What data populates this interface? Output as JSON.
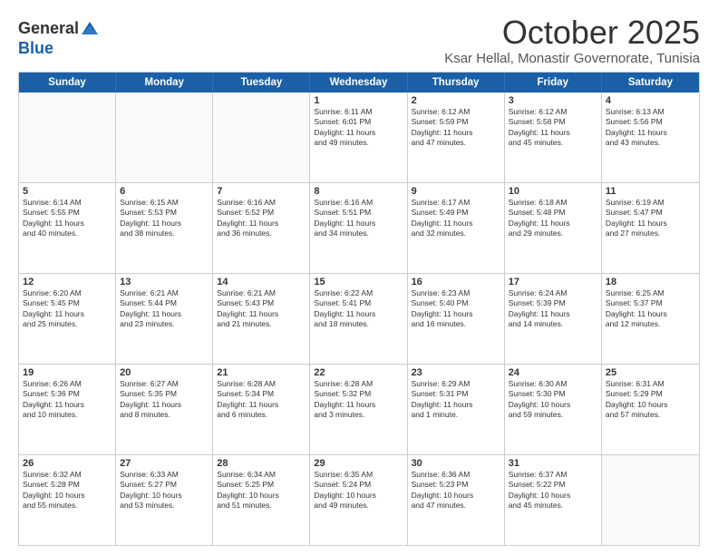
{
  "logo": {
    "general": "General",
    "blue": "Blue"
  },
  "header": {
    "month": "October 2025",
    "location": "Ksar Hellal, Monastir Governorate, Tunisia"
  },
  "weekdays": [
    "Sunday",
    "Monday",
    "Tuesday",
    "Wednesday",
    "Thursday",
    "Friday",
    "Saturday"
  ],
  "rows": [
    [
      {
        "day": "",
        "info": ""
      },
      {
        "day": "",
        "info": ""
      },
      {
        "day": "",
        "info": ""
      },
      {
        "day": "1",
        "info": "Sunrise: 6:11 AM\nSunset: 6:01 PM\nDaylight: 11 hours\nand 49 minutes."
      },
      {
        "day": "2",
        "info": "Sunrise: 6:12 AM\nSunset: 5:59 PM\nDaylight: 11 hours\nand 47 minutes."
      },
      {
        "day": "3",
        "info": "Sunrise: 6:12 AM\nSunset: 5:58 PM\nDaylight: 11 hours\nand 45 minutes."
      },
      {
        "day": "4",
        "info": "Sunrise: 6:13 AM\nSunset: 5:56 PM\nDaylight: 11 hours\nand 43 minutes."
      }
    ],
    [
      {
        "day": "5",
        "info": "Sunrise: 6:14 AM\nSunset: 5:55 PM\nDaylight: 11 hours\nand 40 minutes."
      },
      {
        "day": "6",
        "info": "Sunrise: 6:15 AM\nSunset: 5:53 PM\nDaylight: 11 hours\nand 38 minutes."
      },
      {
        "day": "7",
        "info": "Sunrise: 6:16 AM\nSunset: 5:52 PM\nDaylight: 11 hours\nand 36 minutes."
      },
      {
        "day": "8",
        "info": "Sunrise: 6:16 AM\nSunset: 5:51 PM\nDaylight: 11 hours\nand 34 minutes."
      },
      {
        "day": "9",
        "info": "Sunrise: 6:17 AM\nSunset: 5:49 PM\nDaylight: 11 hours\nand 32 minutes."
      },
      {
        "day": "10",
        "info": "Sunrise: 6:18 AM\nSunset: 5:48 PM\nDaylight: 11 hours\nand 29 minutes."
      },
      {
        "day": "11",
        "info": "Sunrise: 6:19 AM\nSunset: 5:47 PM\nDaylight: 11 hours\nand 27 minutes."
      }
    ],
    [
      {
        "day": "12",
        "info": "Sunrise: 6:20 AM\nSunset: 5:45 PM\nDaylight: 11 hours\nand 25 minutes."
      },
      {
        "day": "13",
        "info": "Sunrise: 6:21 AM\nSunset: 5:44 PM\nDaylight: 11 hours\nand 23 minutes."
      },
      {
        "day": "14",
        "info": "Sunrise: 6:21 AM\nSunset: 5:43 PM\nDaylight: 11 hours\nand 21 minutes."
      },
      {
        "day": "15",
        "info": "Sunrise: 6:22 AM\nSunset: 5:41 PM\nDaylight: 11 hours\nand 18 minutes."
      },
      {
        "day": "16",
        "info": "Sunrise: 6:23 AM\nSunset: 5:40 PM\nDaylight: 11 hours\nand 16 minutes."
      },
      {
        "day": "17",
        "info": "Sunrise: 6:24 AM\nSunset: 5:39 PM\nDaylight: 11 hours\nand 14 minutes."
      },
      {
        "day": "18",
        "info": "Sunrise: 6:25 AM\nSunset: 5:37 PM\nDaylight: 11 hours\nand 12 minutes."
      }
    ],
    [
      {
        "day": "19",
        "info": "Sunrise: 6:26 AM\nSunset: 5:36 PM\nDaylight: 11 hours\nand 10 minutes."
      },
      {
        "day": "20",
        "info": "Sunrise: 6:27 AM\nSunset: 5:35 PM\nDaylight: 11 hours\nand 8 minutes."
      },
      {
        "day": "21",
        "info": "Sunrise: 6:28 AM\nSunset: 5:34 PM\nDaylight: 11 hours\nand 6 minutes."
      },
      {
        "day": "22",
        "info": "Sunrise: 6:28 AM\nSunset: 5:32 PM\nDaylight: 11 hours\nand 3 minutes."
      },
      {
        "day": "23",
        "info": "Sunrise: 6:29 AM\nSunset: 5:31 PM\nDaylight: 11 hours\nand 1 minute."
      },
      {
        "day": "24",
        "info": "Sunrise: 6:30 AM\nSunset: 5:30 PM\nDaylight: 10 hours\nand 59 minutes."
      },
      {
        "day": "25",
        "info": "Sunrise: 6:31 AM\nSunset: 5:29 PM\nDaylight: 10 hours\nand 57 minutes."
      }
    ],
    [
      {
        "day": "26",
        "info": "Sunrise: 6:32 AM\nSunset: 5:28 PM\nDaylight: 10 hours\nand 55 minutes."
      },
      {
        "day": "27",
        "info": "Sunrise: 6:33 AM\nSunset: 5:27 PM\nDaylight: 10 hours\nand 53 minutes."
      },
      {
        "day": "28",
        "info": "Sunrise: 6:34 AM\nSunset: 5:25 PM\nDaylight: 10 hours\nand 51 minutes."
      },
      {
        "day": "29",
        "info": "Sunrise: 6:35 AM\nSunset: 5:24 PM\nDaylight: 10 hours\nand 49 minutes."
      },
      {
        "day": "30",
        "info": "Sunrise: 6:36 AM\nSunset: 5:23 PM\nDaylight: 10 hours\nand 47 minutes."
      },
      {
        "day": "31",
        "info": "Sunrise: 6:37 AM\nSunset: 5:22 PM\nDaylight: 10 hours\nand 45 minutes."
      },
      {
        "day": "",
        "info": ""
      }
    ]
  ]
}
